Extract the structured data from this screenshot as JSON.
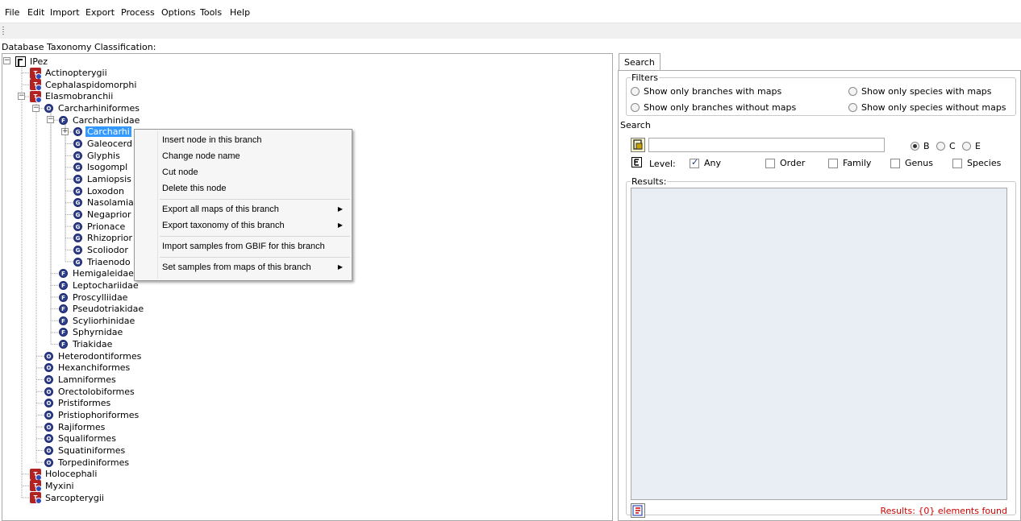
{
  "menu": [
    "File",
    "Edit",
    "Import",
    "Export",
    "Process",
    "Options",
    "Tools",
    "Help"
  ],
  "taxonomy_label": "Database Taxonomy Classification:",
  "tree": [
    {
      "label": "IPez",
      "level": 0,
      "icon": "root",
      "expander": "minus"
    },
    {
      "label": "Actinopterygii",
      "level": 1,
      "icon": "clade"
    },
    {
      "label": "Cephalaspidomorphi",
      "level": 1,
      "icon": "clade"
    },
    {
      "label": "Elasmobranchii",
      "level": 1,
      "icon": "clade",
      "expander": "minus"
    },
    {
      "label": "Carcharhiniformes",
      "level": 2,
      "icon": "order",
      "expander": "minus"
    },
    {
      "label": "Carcharhinidae",
      "level": 3,
      "icon": "family",
      "expander": "minus"
    },
    {
      "label": "Carcharhi",
      "level": 4,
      "icon": "genus",
      "expander": "plus",
      "selected": true
    },
    {
      "label": "Galeocerd",
      "level": 4,
      "icon": "genus"
    },
    {
      "label": "Glyphis",
      "level": 4,
      "icon": "genus"
    },
    {
      "label": "Isogompl",
      "level": 4,
      "icon": "genus"
    },
    {
      "label": "Lamiopsis",
      "level": 4,
      "icon": "genus"
    },
    {
      "label": "Loxodon",
      "level": 4,
      "icon": "genus"
    },
    {
      "label": "Nasolamia",
      "level": 4,
      "icon": "genus"
    },
    {
      "label": "Negaprior",
      "level": 4,
      "icon": "genus"
    },
    {
      "label": "Prionace",
      "level": 4,
      "icon": "genus"
    },
    {
      "label": "Rhizoprior",
      "level": 4,
      "icon": "genus"
    },
    {
      "label": "Scoliodor",
      "level": 4,
      "icon": "genus"
    },
    {
      "label": "Triaenodo",
      "level": 4,
      "icon": "genus"
    },
    {
      "label": "Hemigaleidae",
      "level": 3,
      "icon": "family"
    },
    {
      "label": "Leptochariidae",
      "level": 3,
      "icon": "family"
    },
    {
      "label": "Proscylliidae",
      "level": 3,
      "icon": "family"
    },
    {
      "label": "Pseudotriakidae",
      "level": 3,
      "icon": "family"
    },
    {
      "label": "Scyliorhinidae",
      "level": 3,
      "icon": "family"
    },
    {
      "label": "Sphyrnidae",
      "level": 3,
      "icon": "family"
    },
    {
      "label": "Triakidae",
      "level": 3,
      "icon": "family"
    },
    {
      "label": "Heterodontiformes",
      "level": 2,
      "icon": "order"
    },
    {
      "label": "Hexanchiformes",
      "level": 2,
      "icon": "order"
    },
    {
      "label": "Lamniformes",
      "level": 2,
      "icon": "order"
    },
    {
      "label": "Orectolobiformes",
      "level": 2,
      "icon": "order"
    },
    {
      "label": "Pristiformes",
      "level": 2,
      "icon": "order"
    },
    {
      "label": "Pristiophoriformes",
      "level": 2,
      "icon": "order"
    },
    {
      "label": "Rajiformes",
      "level": 2,
      "icon": "order"
    },
    {
      "label": "Squaliformes",
      "level": 2,
      "icon": "order"
    },
    {
      "label": "Squatiniformes",
      "level": 2,
      "icon": "order"
    },
    {
      "label": "Torpediniformes",
      "level": 2,
      "icon": "order"
    },
    {
      "label": "Holocephali",
      "level": 1,
      "icon": "clade"
    },
    {
      "label": "Myxini",
      "level": 1,
      "icon": "clade"
    },
    {
      "label": "Sarcopterygii",
      "level": 1,
      "icon": "clade"
    }
  ],
  "icon_letters": {
    "order": "O",
    "family": "F",
    "genus": "G"
  },
  "context_menu": {
    "items": [
      {
        "label": "Insert node in this branch",
        "submenu": false
      },
      {
        "label": "Change node name",
        "submenu": false
      },
      {
        "label": "Cut node",
        "submenu": false
      },
      {
        "label": "Delete this node",
        "submenu": false,
        "separator_after": true
      },
      {
        "label": "Export all maps of this branch",
        "submenu": true
      },
      {
        "label": "Export taxonomy of this branch",
        "submenu": true,
        "separator_after": true
      },
      {
        "label": "Import samples from GBIF for this branch",
        "submenu": false,
        "separator_after": true
      },
      {
        "label": "Set samples from maps of this branch",
        "submenu": true
      }
    ]
  },
  "search_panel": {
    "tab_label": "Search",
    "filters_legend": "Filters",
    "filters": [
      {
        "label": "Show only branches with maps",
        "checked": false
      },
      {
        "label": "Show only species with maps",
        "checked": false
      },
      {
        "label": "Show only branches without maps",
        "checked": false
      },
      {
        "label": "Show only species without maps",
        "checked": false
      }
    ],
    "search_legend": "Search",
    "search_value": "",
    "mode_options": [
      {
        "label": "B",
        "checked": true
      },
      {
        "label": "C",
        "checked": false
      },
      {
        "label": "E",
        "checked": false
      }
    ],
    "level_label": "Level:",
    "levels": [
      {
        "label": "Any",
        "checked": true
      },
      {
        "label": "Order",
        "checked": false
      },
      {
        "label": "Family",
        "checked": false
      },
      {
        "label": "Genus",
        "checked": false
      },
      {
        "label": "Species",
        "checked": false
      }
    ],
    "results_legend": "Results:",
    "results_status": "Results: {0} elements found"
  },
  "colors": {
    "selection": "#3399ff",
    "status": "#cc0000",
    "results_bg": "#e8eef4"
  }
}
